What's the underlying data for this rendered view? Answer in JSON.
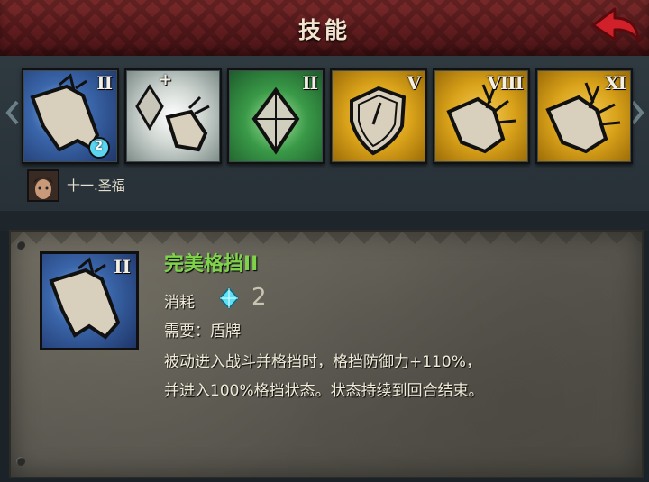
{
  "header": {
    "title": "技能",
    "back_icon": "back-arrow-icon",
    "accent": "#d0202a"
  },
  "skill_bar": {
    "slots": [
      {
        "roman": "II",
        "icon": "broken-shield-icon",
        "bg": "blue",
        "gem_badge": "2"
      },
      {
        "roman": "+",
        "icon": "crystal-and-shield-icon",
        "bg": "white"
      },
      {
        "roman": "II",
        "icon": "crystal-icon",
        "bg": "green"
      },
      {
        "roman": "V",
        "icon": "shield-icon",
        "bg": "gold"
      },
      {
        "roman": "VIII",
        "icon": "cracked-shield-icon",
        "bg": "gold"
      },
      {
        "roman": "XI",
        "icon": "cracked-shield-icon",
        "bg": "gold"
      }
    ],
    "prev_icon": "chevron-left-icon",
    "next_icon": "chevron-right-icon"
  },
  "hero": {
    "name": "十一.圣福",
    "avatar": "hero-portrait"
  },
  "detail": {
    "roman": "II",
    "name": "完美格挡II",
    "cost_label": "消耗",
    "cost_value": "2",
    "cost_icon": "crystal-gem-icon",
    "requirement": "需要：盾牌",
    "description_line1": "被动进入战斗并格挡时，格挡防御力+110%，",
    "description_line2": "并进入100%格挡状态。状态持续到回合结束。"
  },
  "colors": {
    "name_green": "#7fd34a",
    "slot_gold": "#d9a21a",
    "slot_green": "#3a9a48",
    "slot_blue": "#2a4f8a"
  }
}
